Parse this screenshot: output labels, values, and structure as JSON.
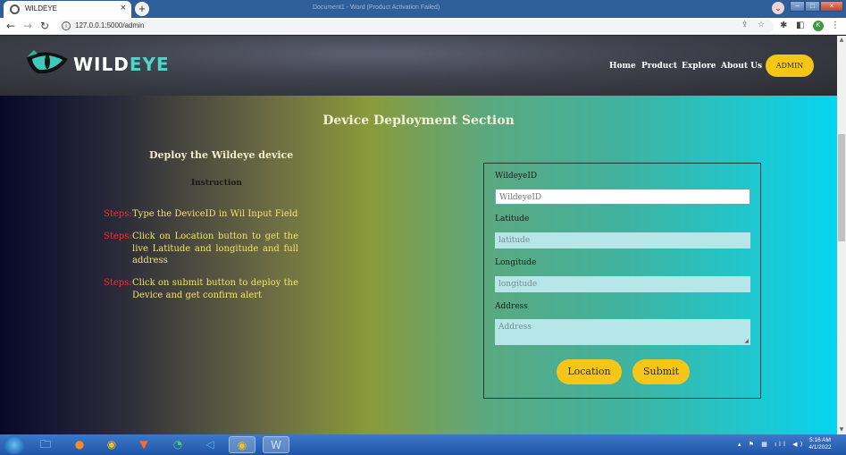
{
  "browser": {
    "tab_title": "WILDEYE",
    "tab_close": "×",
    "new_tab": "+",
    "window_title": "Document1 - Word (Product Activation Failed)",
    "url": "127.0.0.1:5000/admin",
    "profile_initial": "K",
    "nav_back": "←",
    "nav_forward": "→",
    "nav_reload": "↻"
  },
  "header": {
    "logo_text_white": "WILD",
    "logo_text_teal": "EYE",
    "nav_items": [
      "Home",
      "Product",
      "Explore",
      "About Us"
    ],
    "admin_button": "ADMIN"
  },
  "section": {
    "title": "Device Deployment Section",
    "deploy_title": "Deploy the Wildeye device",
    "instruction_title": "Instruction",
    "steps": [
      {
        "label": "Steps:",
        "text": "Type the DeviceID in Wil Input Field"
      },
      {
        "label": "Steps:",
        "text": "Click on Location button to get the live Latitude and longitude and full address"
      },
      {
        "label": "Steps:",
        "text": "Click on submit button to deploy the Device and get confirm alert"
      }
    ]
  },
  "form": {
    "wildeye_label": "WildeyeID",
    "wildeye_placeholder": "WildeyeID",
    "latitude_label": "Latitude",
    "latitude_placeholder": "latitude",
    "longitude_label": "Longitude",
    "longitude_placeholder": "longitude",
    "address_label": "Address",
    "address_placeholder": "Address",
    "location_button": "Location",
    "submit_button": "Submit"
  },
  "taskbar": {
    "time": "5:16 AM",
    "date": "4/1/2022"
  },
  "colors": {
    "accent_yellow": "#f5c518",
    "step_label_red": "#ff2a2a",
    "step_text_yellow": "#f5e36a",
    "logo_teal": "#4fd6c9"
  }
}
